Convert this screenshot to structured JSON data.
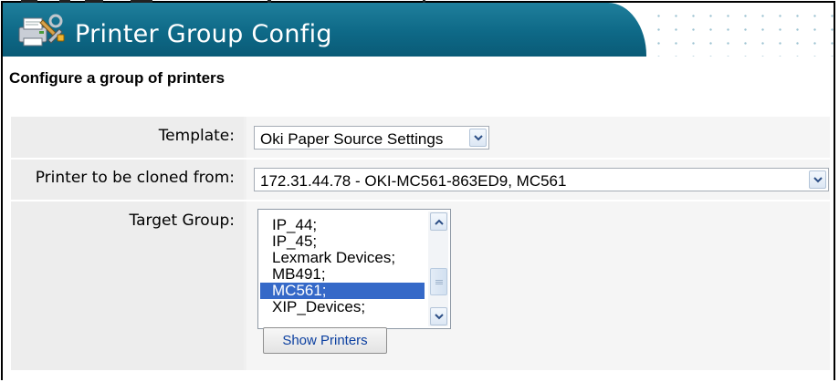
{
  "app": {
    "title": "Printer Group Config",
    "icon": "printer-tools-icon",
    "subtitle": "Configure a group of printers"
  },
  "form": {
    "template": {
      "label": "Template:",
      "value": "Oki Paper Source Settings"
    },
    "clone_from": {
      "label": "Printer to be cloned from:",
      "value": "172.31.44.78 - OKI-MC561-863ED9, MC561"
    },
    "target_group": {
      "label": "Target Group:",
      "items": [
        "IP_44;",
        "IP_45;",
        "Lexmark Devices;",
        "MB491;",
        "MC561;",
        "XIP_Devices;"
      ],
      "selected": "MC561;"
    },
    "show_printers_label": "Show Printers"
  },
  "colors": {
    "banner": "#0e6987",
    "selection": "#3569c8",
    "button_text": "#0b3fa0"
  }
}
